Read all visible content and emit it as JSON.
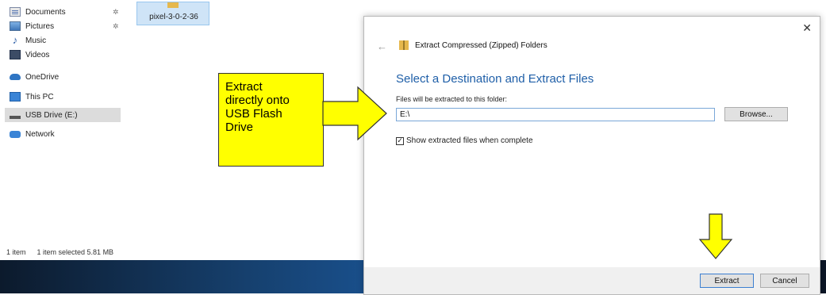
{
  "explorer": {
    "nav_items": [
      {
        "label": "Documents",
        "icon": "documents-icon",
        "pinned": true
      },
      {
        "label": "Pictures",
        "icon": "pictures-icon",
        "pinned": true
      },
      {
        "label": "Music",
        "icon": "music-icon",
        "pinned": false
      },
      {
        "label": "Videos",
        "icon": "videos-icon",
        "pinned": false
      },
      {
        "label": "OneDrive",
        "icon": "onedrive-icon",
        "pinned": false
      },
      {
        "label": "This PC",
        "icon": "this-pc-icon",
        "pinned": false
      },
      {
        "label": "USB Drive (E:)",
        "icon": "usb-drive-icon",
        "pinned": false,
        "selected": true
      },
      {
        "label": "Network",
        "icon": "network-icon",
        "pinned": false
      }
    ],
    "pin_glyph": "✲",
    "selected_file": "pixel-3-0-2-36",
    "status": {
      "count": "1 item",
      "selection": "1 item selected  5.81 MB"
    }
  },
  "callout": {
    "text_lines": [
      "Extract",
      "directly onto",
      "USB Flash",
      "Drive"
    ],
    "color": "#ffff00"
  },
  "dialog": {
    "close_glyph": "✕",
    "back_glyph": "←",
    "title": "Extract Compressed (Zipped) Folders",
    "heading": "Select a Destination and Extract Files",
    "destination_label": "Files will be extracted to this folder:",
    "destination_value": "E:\\",
    "browse_label": "Browse...",
    "show_files_label": "Show extracted files when complete",
    "show_files_checked": true,
    "check_glyph": "✓",
    "extract_label": "Extract",
    "cancel_label": "Cancel",
    "accent_color": "#1f5fa8"
  }
}
